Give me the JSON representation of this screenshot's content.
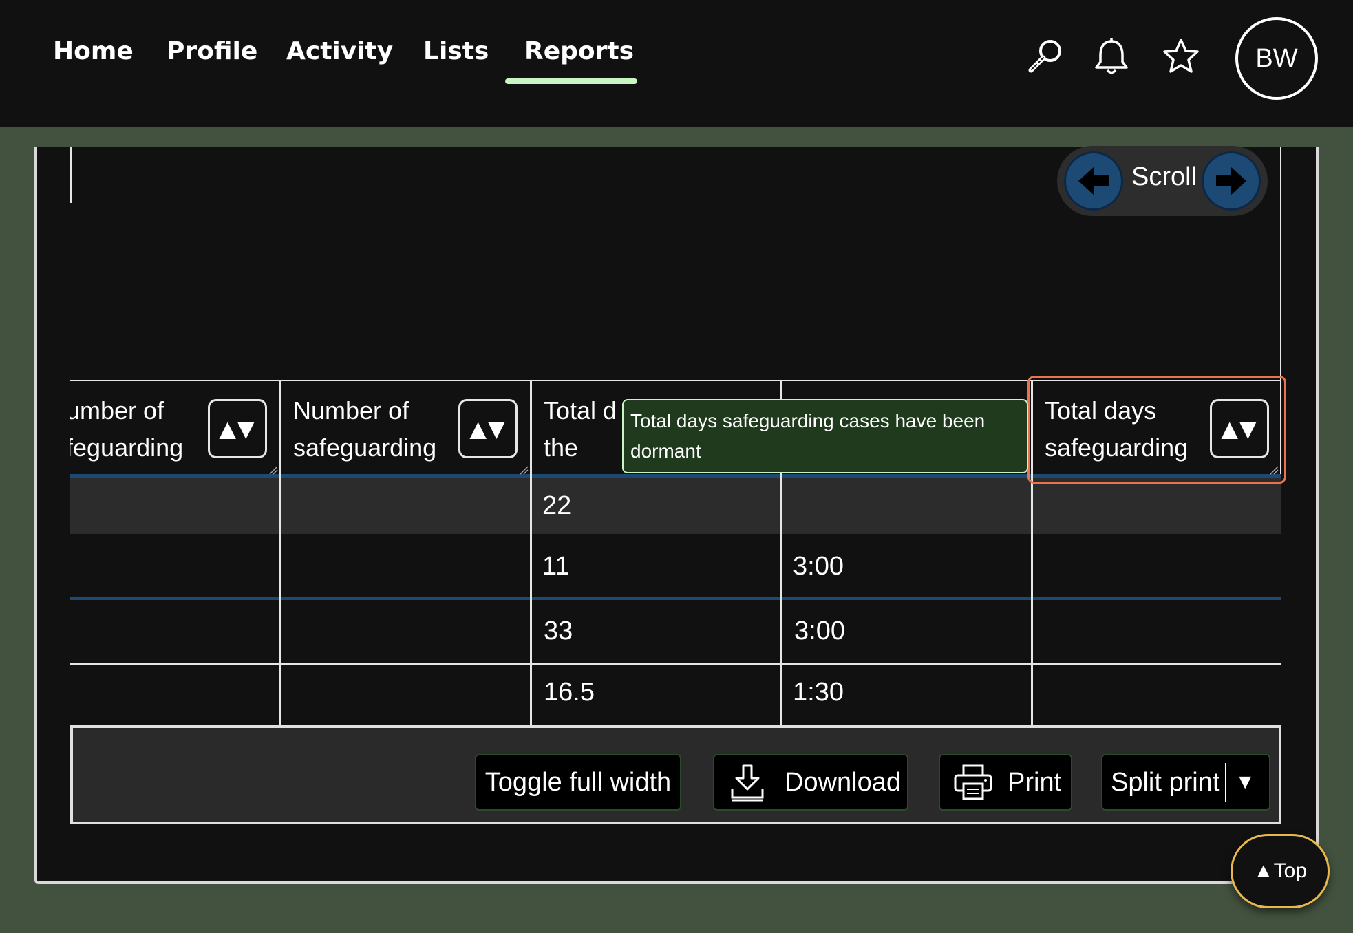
{
  "nav": {
    "items": [
      {
        "label": "Home"
      },
      {
        "label": "Profile"
      },
      {
        "label": "Activity"
      },
      {
        "label": "Lists"
      },
      {
        "label": "Reports",
        "active": true
      }
    ],
    "icons": [
      "search-icon",
      "bell-icon",
      "star-icon"
    ],
    "avatar_initials": "BW",
    "accent_color": "#c9f5c4"
  },
  "scroll": {
    "label": "Scroll"
  },
  "table": {
    "headers": [
      {
        "line1": "umber of",
        "line2": "feguarding"
      },
      {
        "line1": "Number of",
        "line2": "safeguarding"
      },
      {
        "line1": "Total d",
        "line2": "the"
      },
      {
        "line1": "",
        "line2": ""
      },
      {
        "line1": "Total days",
        "line2": "safeguarding"
      }
    ],
    "sort_glyph": "▲▼",
    "rows": [
      [
        "",
        "",
        "22",
        "",
        ""
      ],
      [
        "",
        "",
        "11",
        "3:00",
        ""
      ],
      [
        "",
        "",
        "33",
        "3:00",
        ""
      ],
      [
        "",
        "",
        "16.5",
        "1:30",
        ""
      ]
    ]
  },
  "tooltip": {
    "text": "Total days safeguarding cases have been dormant"
  },
  "toolbar": {
    "toggle_label": "Toggle full width",
    "download_label": "Download",
    "print_label": "Print",
    "split_print_label": "Split print",
    "split_caret": "▼"
  },
  "back_to_top": {
    "label": "▲Top"
  },
  "colors": {
    "background": "#43523f",
    "panel": "#111111",
    "header_rule": "#1c4a75",
    "focus": "#e8754f",
    "tooltip_bg": "#1f3a1c",
    "top_button_border": "#e8b94a"
  }
}
